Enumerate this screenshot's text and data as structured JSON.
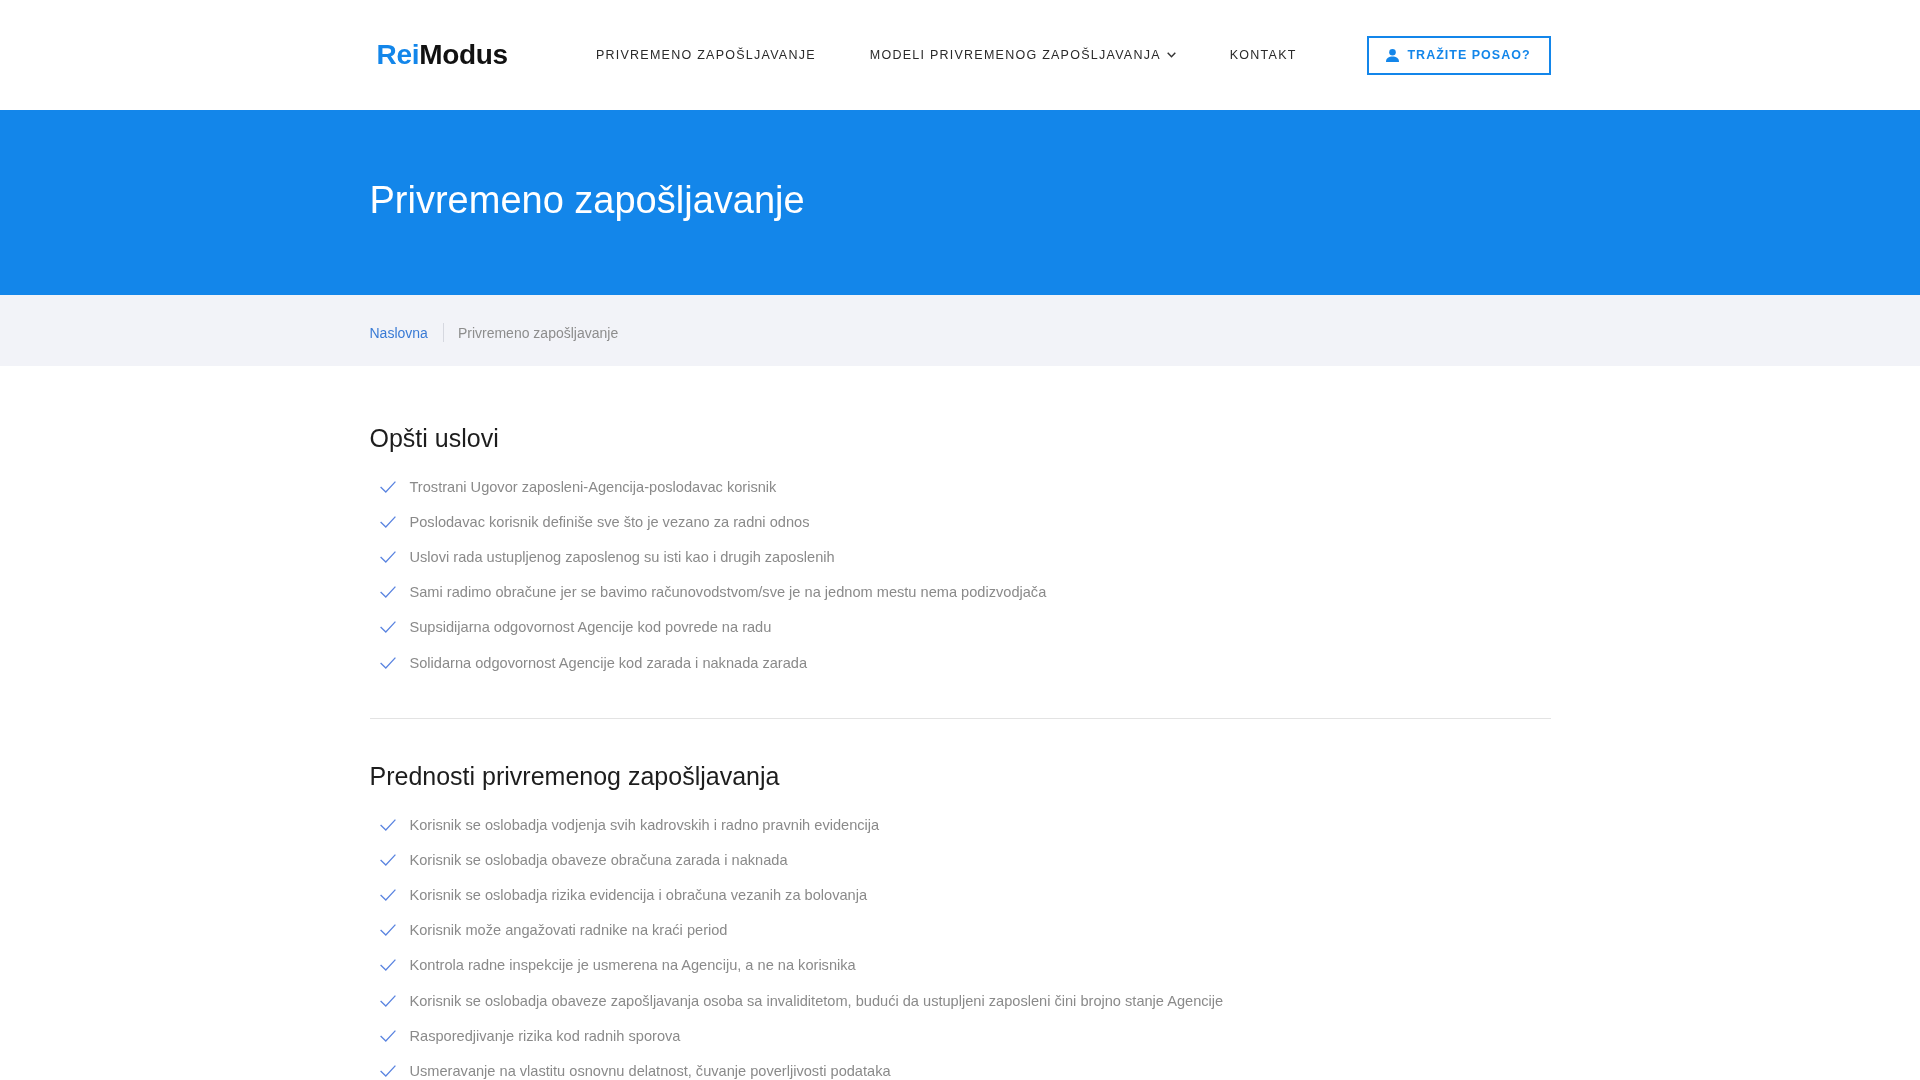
{
  "header": {
    "logo": {
      "accent": "Rei",
      "rest": "Modus"
    },
    "nav": [
      {
        "label": "PRIVREMENO ZAPOŠLJAVANJE",
        "kind": "link"
      },
      {
        "label": "MODELI PRIVREMENOG ZAPOŠLJAVANJA",
        "kind": "dropdown"
      },
      {
        "label": "KONTAKT",
        "kind": "link"
      }
    ],
    "cta_button": {
      "label": "TRAŽITE POSAO?"
    }
  },
  "hero": {
    "title": "Privremeno zapošljavanje"
  },
  "breadcrumb": [
    {
      "label": "Naslovna",
      "kind": "link"
    },
    {
      "label": "Privremeno zapošljavanje",
      "kind": "current"
    }
  ],
  "sections": [
    {
      "title": "Opšti uslovi",
      "items": [
        "Trostrani Ugovor zaposleni-Agencija-poslodavac korisnik",
        "Poslodavac korisnik definiše sve što je vezano za radni odnos",
        "Uslovi rada ustupljenog zaposlenog su isti kao i drugih zaposlenih",
        "Sami radimo obračune jer se bavimo računovodstvom/sve je na jednom mestu nema podizvodjača",
        "Supsidijarna odgovornost Agencije kod povrede na radu",
        "Solidarna odgovornost Agencije kod zarada i naknada zarada"
      ]
    },
    {
      "title": "Prednosti privremenog zapošljavanja",
      "items": [
        "Korisnik se oslobadja vodjenja svih kadrovskih i radno pravnih evidencija",
        "Korisnik se oslobadja obaveze obračuna zarada i naknada",
        "Korisnik se oslobadja rizika evidencija i obračuna vezanih za bolovanja",
        "Korisnik može angažovati radnike na kraći period",
        "Kontrola radne inspekcije je usmerena na Agenciju, a ne na korisnika",
        "Korisnik se oslobadja obaveze zapošljavanja osoba sa invaliditetom, budući da ustupljeni zaposleni čini brojno stanje Agencije",
        "Rasporedjivanje rizika kod radnih sporova",
        "Usmeravanje na vlastitu osnovnu delatnost, čuvanje poverljivosti podataka"
      ]
    }
  ]
}
